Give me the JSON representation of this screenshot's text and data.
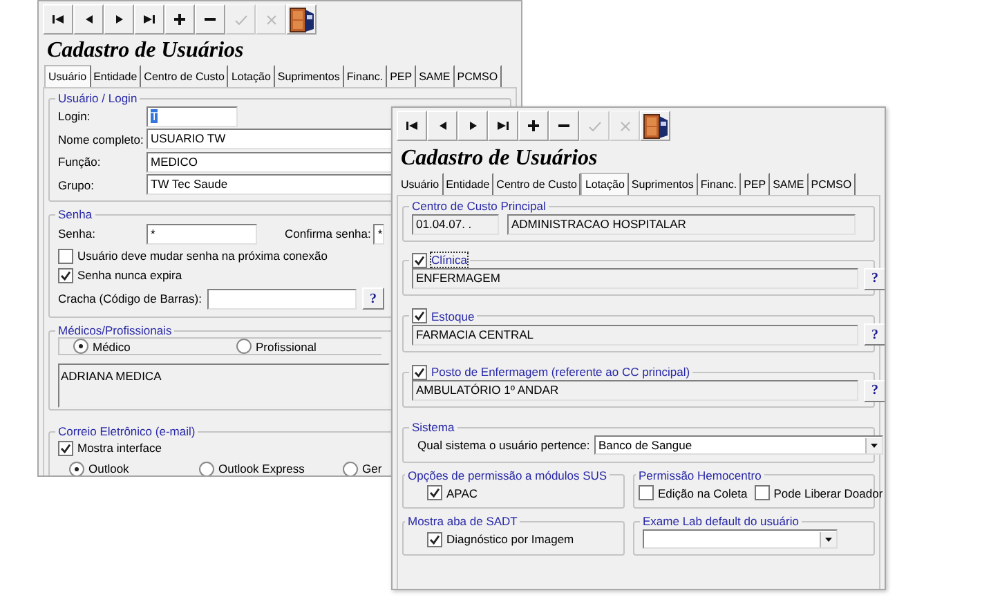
{
  "back_window": {
    "title": "Cadastro de Usuários",
    "toolbar": [
      {
        "kind": "first",
        "disabled": false
      },
      {
        "kind": "prev",
        "disabled": false
      },
      {
        "kind": "next",
        "disabled": false
      },
      {
        "kind": "last",
        "disabled": false
      },
      {
        "kind": "add",
        "disabled": false
      },
      {
        "kind": "remove",
        "disabled": false
      },
      {
        "kind": "confirm",
        "disabled": true
      },
      {
        "kind": "cancel",
        "disabled": true
      },
      {
        "kind": "exit",
        "disabled": false
      }
    ],
    "tabs": [
      {
        "label": "Usuário",
        "selected": true
      },
      {
        "label": "Entidade",
        "selected": false
      },
      {
        "label": "Centro de Custo",
        "selected": false
      },
      {
        "label": "Lotação",
        "selected": false
      },
      {
        "label": "Suprimentos",
        "selected": false
      },
      {
        "label": "Financ.",
        "selected": false
      },
      {
        "label": "PEP",
        "selected": false
      },
      {
        "label": "SAME",
        "selected": false
      },
      {
        "label": "PCMSO",
        "selected": false
      }
    ],
    "login_group": {
      "legend": "Usuário / Login",
      "fields": [
        {
          "label": "Login:",
          "value": "T",
          "highlighted": true
        },
        {
          "label": "Nome completo:",
          "value": "USUARIO TW",
          "highlighted": false
        },
        {
          "label": "Função:",
          "value": "MEDICO",
          "highlighted": false
        },
        {
          "label": "Grupo:",
          "value": "TW Tec Saude",
          "highlighted": false
        }
      ]
    },
    "password_group": {
      "legend": "Senha",
      "password": {
        "label": "Senha:",
        "value": "*"
      },
      "confirm": {
        "label": "Confirma senha:",
        "value": "*"
      },
      "checkboxes": [
        {
          "label": "Usuário deve mudar senha na próxima conexão",
          "checked": false
        },
        {
          "label": "Senha nunca expira",
          "checked": true
        }
      ],
      "badge": {
        "label": "Cracha (Código de Barras):",
        "button": "?"
      }
    },
    "doctors_group": {
      "legend": "Médicos/Profissionais",
      "radios": [
        {
          "label": "Médico",
          "selected": true
        },
        {
          "label": "Profissional",
          "selected": false
        }
      ],
      "list": [
        "ADRIANA MEDICA"
      ]
    },
    "email_group": {
      "legend": "Correio Eletrônico (e-mail)",
      "checkbox": {
        "label": "Mostra interface",
        "checked": true
      },
      "radios": [
        {
          "label": "Outlook",
          "selected": true
        },
        {
          "label": "Outlook Express",
          "selected": false
        },
        {
          "label": "Ger",
          "selected": false
        }
      ]
    }
  },
  "front_window": {
    "title": "Cadastro de Usuários",
    "toolbar": [
      {
        "kind": "first",
        "disabled": false
      },
      {
        "kind": "prev",
        "disabled": false
      },
      {
        "kind": "next",
        "disabled": false
      },
      {
        "kind": "last",
        "disabled": false
      },
      {
        "kind": "add",
        "disabled": false
      },
      {
        "kind": "remove",
        "disabled": false
      },
      {
        "kind": "confirm",
        "disabled": true
      },
      {
        "kind": "cancel",
        "disabled": true
      },
      {
        "kind": "exit",
        "disabled": false
      }
    ],
    "tabs": [
      {
        "label": "Usuário",
        "selected": false
      },
      {
        "label": "Entidade",
        "selected": false
      },
      {
        "label": "Centro de Custo",
        "selected": false
      },
      {
        "label": "Lotação",
        "selected": true
      },
      {
        "label": "Suprimentos",
        "selected": false
      },
      {
        "label": "Financ.",
        "selected": false
      },
      {
        "label": "PEP",
        "selected": false
      },
      {
        "label": "SAME",
        "selected": false
      },
      {
        "label": "PCMSO",
        "selected": false
      }
    ],
    "cost_center": {
      "legend": "Centro de Custo Principal",
      "code": "01.04.07. .",
      "name": "ADMINISTRACAO HOSPITALAR"
    },
    "lookups": [
      {
        "label": "Clínica",
        "checked": true,
        "focused": true,
        "value": "ENFERMAGEM",
        "button": "?"
      },
      {
        "label": "Estoque",
        "checked": true,
        "focused": false,
        "value": "FARMACIA CENTRAL",
        "button": "?"
      },
      {
        "label": "Posto de Enfermagem (referente ao CC principal)",
        "checked": true,
        "focused": false,
        "value": "AMBULATÓRIO 1º ANDAR",
        "button": "?"
      }
    ],
    "system": {
      "legend": "Sistema",
      "label": "Qual sistema o usuário pertence:",
      "value": "Banco de Sangue"
    },
    "sus": {
      "legend": "Opções de permissão a módulos SUS",
      "checkboxes": [
        {
          "label": "APAC",
          "checked": true
        }
      ]
    },
    "hemocentro": {
      "legend": "Permissão Hemocentro",
      "checkboxes": [
        {
          "label": "Edição na Coleta",
          "checked": false
        },
        {
          "label": "Pode Liberar Doador",
          "checked": false
        }
      ]
    },
    "sadt": {
      "legend": "Mostra aba de SADT",
      "checkboxes": [
        {
          "label": "Diagnóstico por Imagem",
          "checked": true
        }
      ]
    },
    "exam": {
      "legend": "Exame Lab default do usuário"
    }
  }
}
